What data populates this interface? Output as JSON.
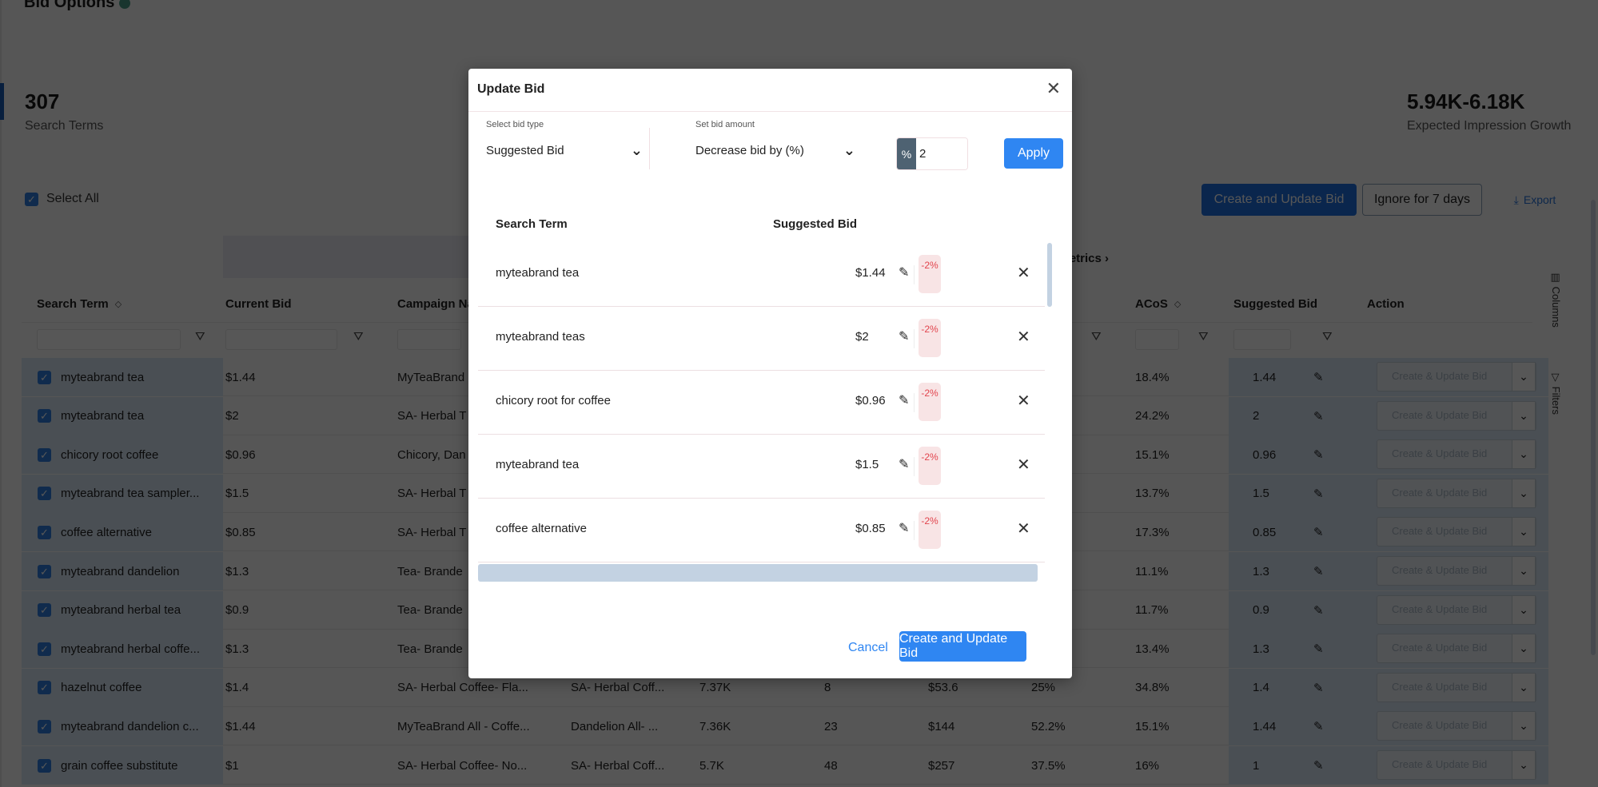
{
  "page": {
    "title": "Bid Options",
    "stats": {
      "search_terms": {
        "value": "307",
        "label": "Search Terms"
      },
      "impression_growth": {
        "value": "5.94K-6.18K",
        "label": "Expected Impression Growth"
      }
    },
    "select_all_label": "Select All",
    "toolbar": {
      "create_update_label": "Create and Update Bid",
      "ignore_label": "Ignore for 7 days",
      "export_label": "Export"
    },
    "grid": {
      "group_header": "l Metrics",
      "columns": {
        "search_term": "Search Term",
        "current_bid": "Current Bid",
        "campaign_name": "Campaign Na",
        "acos": "ACoS",
        "suggested_bid": "Suggested Bid",
        "action": "Action"
      },
      "action_placeholder": "Create & Update Bid",
      "rows": [
        {
          "term": "myteabrand tea",
          "current_bid": "$1.44",
          "campaign": "MyTeaBrand",
          "ad_group": "",
          "impressions": "",
          "orders": "",
          "sales": "",
          "cr": "",
          "acos": "18.4%",
          "suggested": "1.44"
        },
        {
          "term": "myteabrand tea",
          "current_bid": "$2",
          "campaign": "SA- Herbal T",
          "ad_group": "",
          "impressions": "",
          "orders": "",
          "sales": "",
          "cr": "",
          "acos": "24.2%",
          "suggested": "2"
        },
        {
          "term": "chicory root coffee",
          "current_bid": "$0.96",
          "campaign": "Chicory, Dan",
          "ad_group": "",
          "impressions": "",
          "orders": "",
          "sales": "",
          "cr": "",
          "acos": "15.1%",
          "suggested": "0.96"
        },
        {
          "term": "myteabrand tea sampler...",
          "current_bid": "$1.5",
          "campaign": "SA- Herbal T",
          "ad_group": "",
          "impressions": "",
          "orders": "",
          "sales": "",
          "cr": "",
          "acos": "13.7%",
          "suggested": "1.5"
        },
        {
          "term": "coffee alternative",
          "current_bid": "$0.85",
          "campaign": "SA- Herbal T",
          "ad_group": "",
          "impressions": "",
          "orders": "",
          "sales": "",
          "cr": "",
          "acos": "17.3%",
          "suggested": "0.85"
        },
        {
          "term": "myteabrand dandelion",
          "current_bid": "$1.3",
          "campaign": "Tea- Brande",
          "ad_group": "",
          "impressions": "",
          "orders": "",
          "sales": "",
          "cr": "",
          "acos": "11.1%",
          "suggested": "1.3"
        },
        {
          "term": "myteabrand herbal tea",
          "current_bid": "$0.9",
          "campaign": "Tea- Brande",
          "ad_group": "",
          "impressions": "",
          "orders": "",
          "sales": "",
          "cr": "",
          "acos": "11.7%",
          "suggested": "0.9"
        },
        {
          "term": "myteabrand herbal coffe...",
          "current_bid": "$1.3",
          "campaign": "Tea- Brande",
          "ad_group": "",
          "impressions": "",
          "orders": "",
          "sales": "",
          "cr": "",
          "acos": "13.4%",
          "suggested": "1.3"
        },
        {
          "term": "hazelnut coffee",
          "current_bid": "$1.4",
          "campaign": "SA- Herbal Coffee- Fla...",
          "ad_group": "SA- Herbal Coff...",
          "impressions": "7.37K",
          "orders": "8",
          "sales": "$53.6",
          "cr": "25%",
          "acos": "34.8%",
          "suggested": "1.4"
        },
        {
          "term": "myteabrand dandelion c...",
          "current_bid": "$1.44",
          "campaign": "MyTeaBrand All - Coffe...",
          "ad_group": "Dandelion All- ...",
          "impressions": "7.36K",
          "orders": "23",
          "sales": "$144",
          "cr": "52.2%",
          "acos": "15.1%",
          "suggested": "1.44"
        },
        {
          "term": "grain coffee substitute",
          "current_bid": "$1",
          "campaign": "SA- Herbal Coffee- No...",
          "ad_group": "SA- Herbal Coff...",
          "impressions": "5.7K",
          "orders": "48",
          "sales": "$257",
          "cr": "37.5%",
          "acos": "16%",
          "suggested": "1"
        }
      ]
    },
    "side_tabs": {
      "columns": "Columns",
      "filters": "Filters"
    }
  },
  "modal": {
    "title": "Update Bid",
    "bid_type": {
      "label": "Select bid type",
      "value": "Suggested Bid"
    },
    "bid_amount": {
      "label": "Set bid amount",
      "value": "Decrease bid by (%)"
    },
    "percent": {
      "addon": "%",
      "value": "2"
    },
    "apply_label": "Apply",
    "table": {
      "headers": {
        "search_term": "Search Term",
        "suggested_bid": "Suggested Bid"
      },
      "rows": [
        {
          "term": "myteabrand tea",
          "bid": "$1.44",
          "change": "-2%"
        },
        {
          "term": "myteabrand teas",
          "bid": "$2",
          "change": "-2%"
        },
        {
          "term": "chicory root for coffee",
          "bid": "$0.96",
          "change": "-2%"
        },
        {
          "term": "myteabrand tea",
          "bid": "$1.5",
          "change": "-2%"
        },
        {
          "term": "coffee alternative",
          "bid": "$0.85",
          "change": "-2%"
        }
      ]
    },
    "cancel_label": "Cancel",
    "submit_label": "Create and Update Bid"
  },
  "colors": {
    "primary": "#2f86f2",
    "badge_text": "#e2454e",
    "badge_bg": "#f8e4e5",
    "overlay": "rgba(0,0,0,0.66)"
  }
}
